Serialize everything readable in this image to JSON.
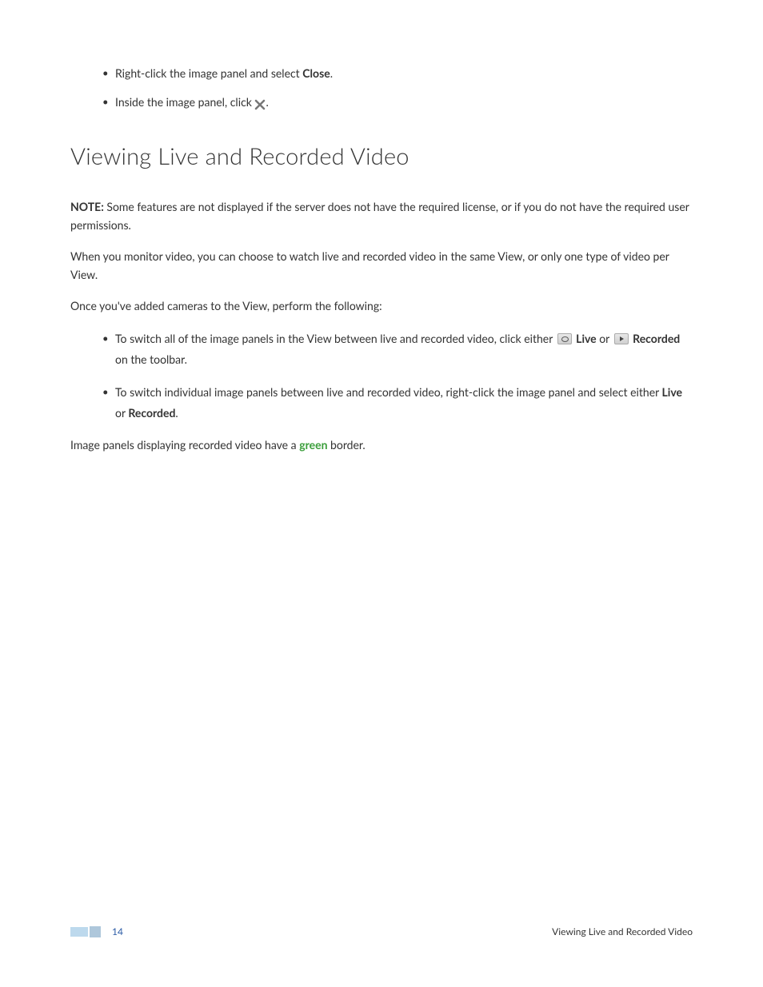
{
  "topList": {
    "item1": {
      "pre": "Right-click the image panel and select ",
      "bold": "Close",
      "post": "."
    },
    "item2": {
      "pre": "Inside the image panel, click ",
      "post": "."
    }
  },
  "heading": "Viewing Live and Recorded Video",
  "note": {
    "label": "NOTE:",
    "text": " Some features are not displayed if the server does not have the required license, or if you do not have the required user permissions."
  },
  "para1": "When you monitor video, you can choose to watch live and recorded video in the same View, or only one type of video per View.",
  "para2": "Once you've added cameras to the View, perform the following:",
  "innerList": {
    "item1": {
      "pre": "To switch all of the image panels in the View between live and recorded video, click either ",
      "boldLive": "Live",
      "mid": " or ",
      "boldRec": "Recorded",
      "post": " on the toolbar."
    },
    "item2": {
      "pre": "To switch individual image panels between live and recorded video, right-click the image panel and select either ",
      "boldLive": "Live",
      "mid": " or ",
      "boldRec": "Recorded",
      "post": "."
    }
  },
  "lastPara": {
    "pre": "Image panels displaying recorded video have a ",
    "green": "green",
    "post": " border."
  },
  "footer": {
    "pageNum": "14",
    "title": "Viewing Live and Recorded Video"
  }
}
